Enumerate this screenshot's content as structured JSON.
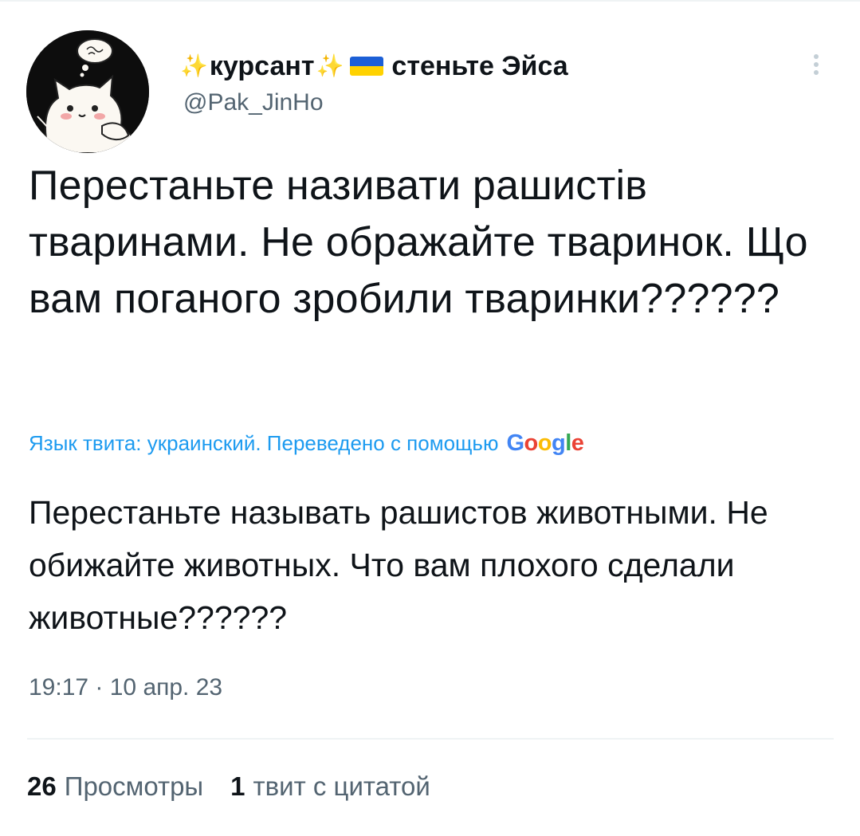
{
  "author": {
    "name_prefix": "✨",
    "name_a": "курсант",
    "name_mid": "✨",
    "name_b": "стеньте Эйса",
    "handle": "@Pak_JinHo"
  },
  "tweet": {
    "text_original": "Перестаньте називати рашистів тваринами. Не ображайте тваринок. Що вам поганого зробили тваринки??????",
    "translation_label": "Язык твита: украинский. Переведено с помощью",
    "translation_provider": "Google",
    "text_translated": "Перестаньте называть рашистов животными. Не обижайте животных. Что вам плохого сделали животные??????",
    "timestamp": "19:17 · 10 апр. 23"
  },
  "stats": {
    "views_count": "26",
    "views_label": "Просмотры",
    "quotes_count": "1",
    "quotes_label": "твит с цитатой"
  },
  "colors": {
    "link": "#1d9bf0",
    "secondary_text": "#536471",
    "primary_text": "#0f1419",
    "flag_blue": "#1c5fd6",
    "flag_yellow": "#ffd200"
  },
  "icons": {
    "sparkles": "sparkles-icon",
    "flag": "ukraine-flag-icon",
    "more": "more-vertical-icon"
  }
}
